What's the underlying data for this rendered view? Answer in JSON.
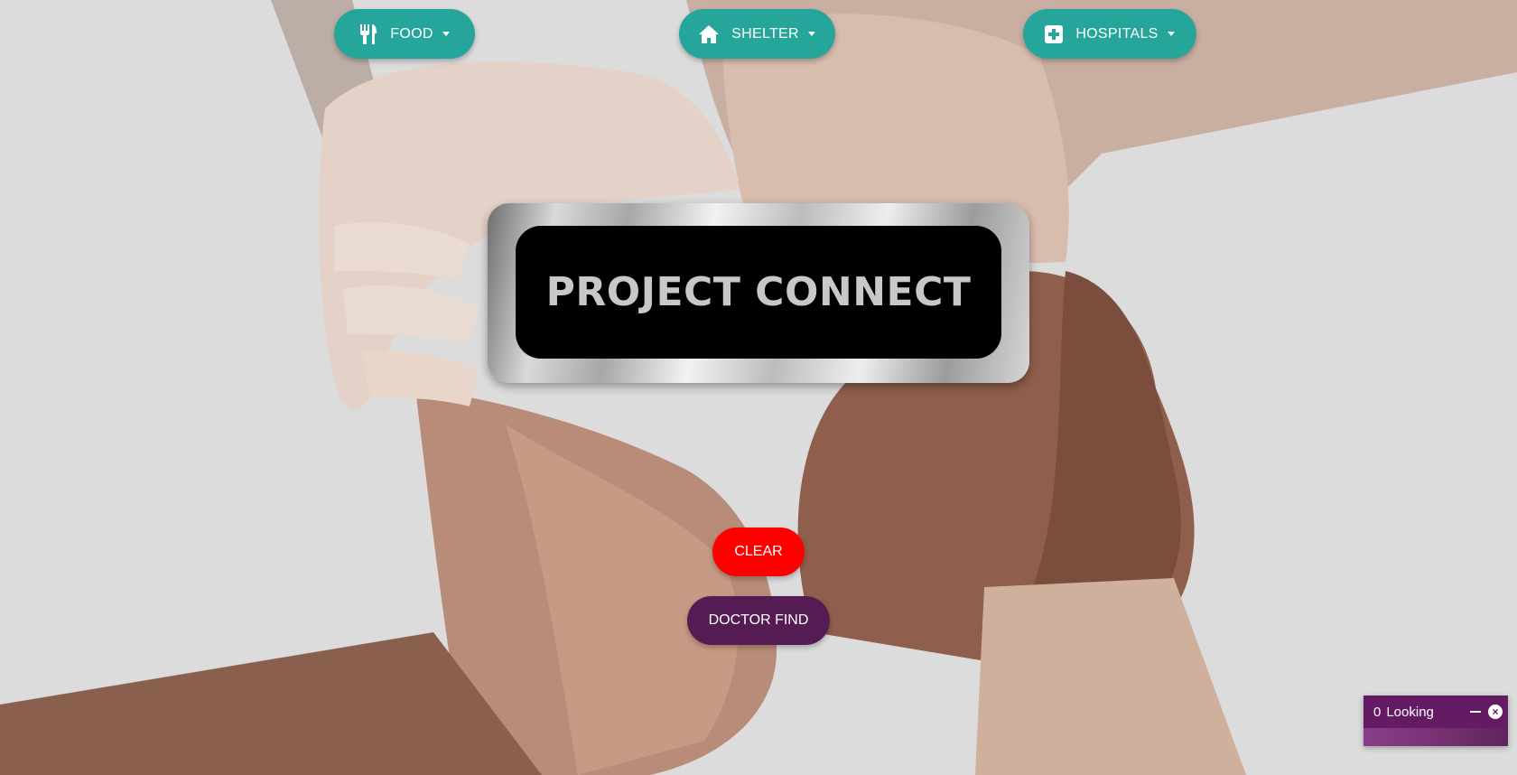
{
  "nav": {
    "food": {
      "label": "FOOD",
      "icon": "utensils-icon"
    },
    "shelter": {
      "label": "SHELTER",
      "icon": "home-icon"
    },
    "hospitals": {
      "label": "HOSPITALS",
      "icon": "hospital-plus-icon"
    }
  },
  "hero": {
    "title": "PROJECT CONNECT"
  },
  "actions": {
    "clear": {
      "label": "CLEAR"
    },
    "doctor_find": {
      "label": "DOCTOR FIND"
    }
  },
  "chat": {
    "count": "0",
    "title": "Looking",
    "close_glyph": "×"
  },
  "colors": {
    "nav_button": "#26a69a",
    "clear_button": "#ff0000",
    "doctor_button": "#551c54",
    "chat_widget": "#651a64"
  }
}
